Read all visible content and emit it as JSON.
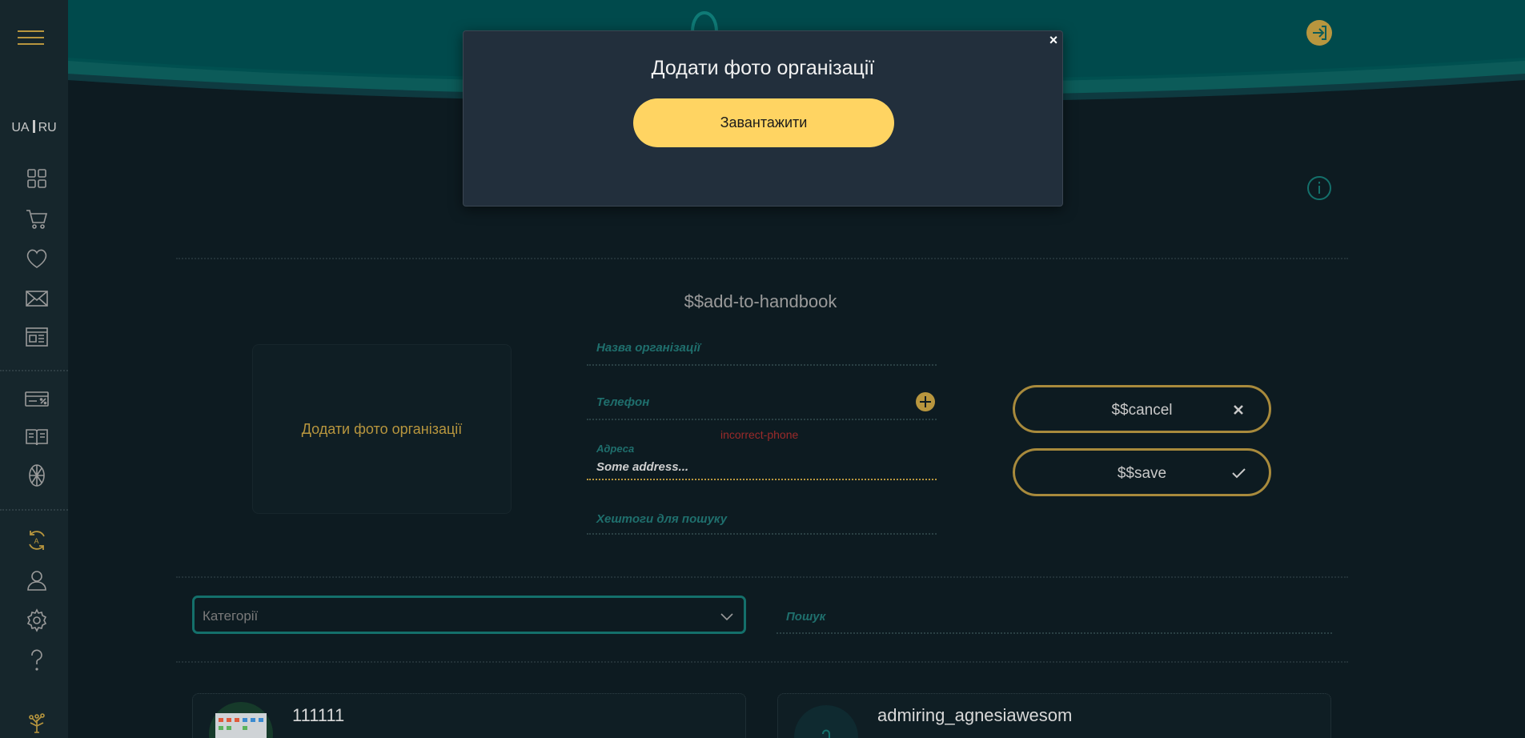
{
  "sidebar": {
    "languages": [
      "UA",
      "RU"
    ],
    "icons": [
      "dashboard-icon",
      "cart-icon",
      "heart-icon",
      "mail-icon",
      "newspaper-icon",
      "discount-card-icon",
      "book-icon",
      "wheel-icon",
      "sync-icon",
      "user-icon",
      "settings-icon",
      "help-icon",
      "tree-icon"
    ]
  },
  "header": {
    "login_icon": "login-icon",
    "info_icon": "info-icon"
  },
  "form": {
    "title": "$$add-to-handbook",
    "photo_label": "Додати фото організації",
    "org_name_placeholder": "Назва організації",
    "phone_placeholder": "Телефон",
    "phone_error": "incorrect-phone",
    "address_label": "Адреса",
    "address_value": "Some address...",
    "hashtags_placeholder": "Хештоги для пошуку",
    "cancel_label": "$$cancel",
    "save_label": "$$save"
  },
  "filters": {
    "categories_placeholder": "Категорії",
    "search_placeholder": "Пошук"
  },
  "cards": [
    {
      "name": "111111"
    },
    {
      "name": "admiring_agnesiawesom"
    }
  ],
  "modal": {
    "title": "Додати фото організації",
    "upload_label": "Завантажити",
    "close_label": "×"
  },
  "colors": {
    "accent": "#b8963e",
    "upload_button": "#ffd462",
    "teal": "#0d5c58",
    "error": "#9b2a2a"
  }
}
